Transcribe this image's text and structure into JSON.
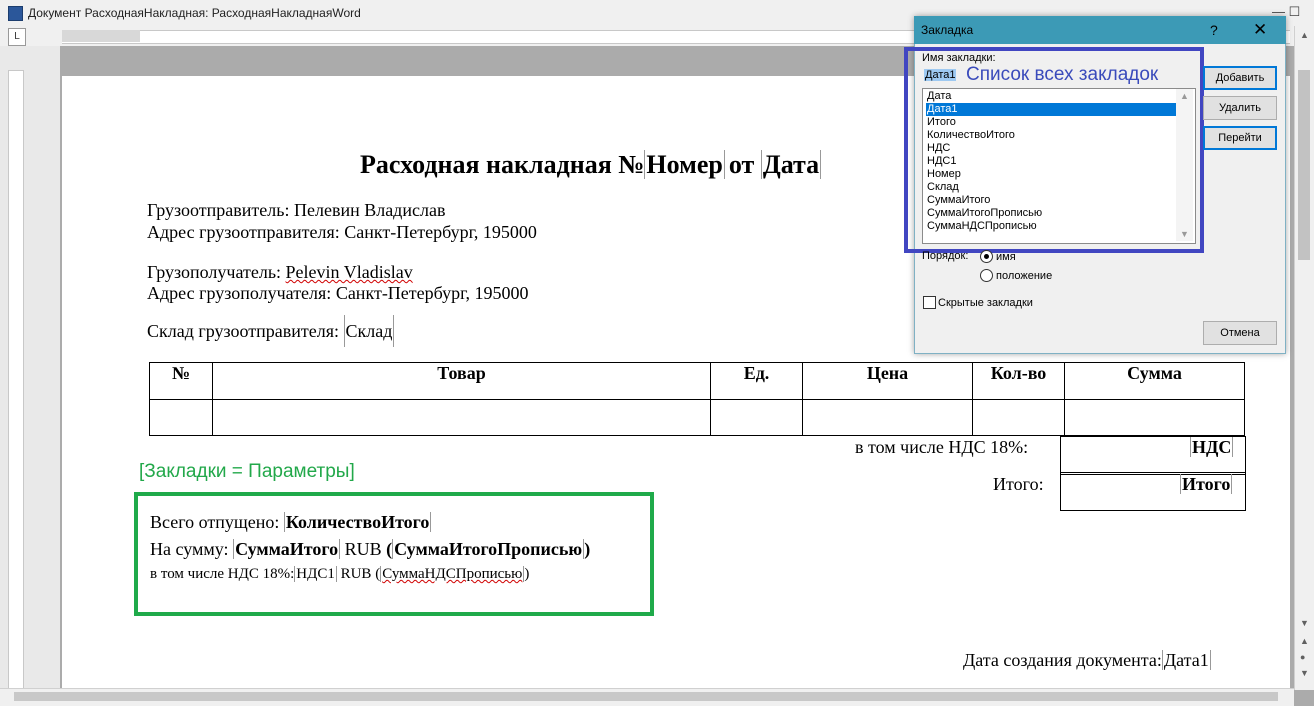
{
  "window": {
    "title": "Документ РасходнаяНакладная: РасходнаяНакладнаяWord",
    "controls": "—  ☐"
  },
  "ruler": {
    "tab_selector": "L"
  },
  "document": {
    "title_prefix": "Расходная накладная №",
    "title_number": "Номер",
    "title_mid": "от",
    "title_date": "Дата",
    "shipper_label": "Грузоотправитель:",
    "shipper_value": "Пелевин Владислав",
    "shipper_addr_label": "Адрес грузоотправителя:",
    "shipper_addr_value": "Санкт-Петербург, 195000",
    "consignee_label": "Грузополучатель:",
    "consignee_value": "Pelevin Vladislav",
    "consignee_addr_label": "Адрес грузополучателя:",
    "consignee_addr_value": "Санкт-Петербург, 195000",
    "warehouse_label": "Склад грузоотправителя:",
    "warehouse_value": "Склад",
    "table_headers": [
      "№",
      "Товар",
      "Ед.",
      "Цена",
      "Кол-во",
      "Сумма"
    ],
    "vat_label": "в том числе НДС 18%:",
    "vat_value": "НДС",
    "total_label": "Итого:",
    "total_value": "Итого",
    "green_note": "[Закладки = Параметры]",
    "released_label": "Всего отпущено:",
    "released_value": "КоличествоИтого",
    "sum_label": "На сумму:",
    "sum_value": "СуммаИтого",
    "currency": "RUB",
    "sum_words": "СуммаИтогоПрописью",
    "vat_line_label": "в том числе НДС 18%:",
    "vat_line_value": "НДС1",
    "vat_words": "СуммаНДСПрописью",
    "created_label": "Дата создания документа:",
    "created_value": "Дата1"
  },
  "dialog": {
    "title": "Закладка",
    "help": "?",
    "close": "✕",
    "name_label": "Имя закладки:",
    "name_value": "Дата1",
    "annotation": "Список всех закладок",
    "bookmarks": [
      "Дата",
      "Дата1",
      "Итого",
      "КоличествоИтого",
      "НДС",
      "НДС1",
      "Номер",
      "Склад",
      "СуммаИтого",
      "СуммаИтогоПрописью",
      "СуммаНДСПрописью"
    ],
    "selected_index": 1,
    "add_button": "Добавить",
    "delete_button": "Удалить",
    "goto_button": "Перейти",
    "sort_label": "Порядок:",
    "sort_name": "имя",
    "sort_position": "положение",
    "hidden_label": "Скрытые закладки",
    "cancel_button": "Отмена"
  },
  "colors": {
    "dialog_title": "#3c9ab6",
    "annotation_blue": "#4146c1",
    "annotation_green": "#1faa4a",
    "selection": "#0078d7"
  }
}
